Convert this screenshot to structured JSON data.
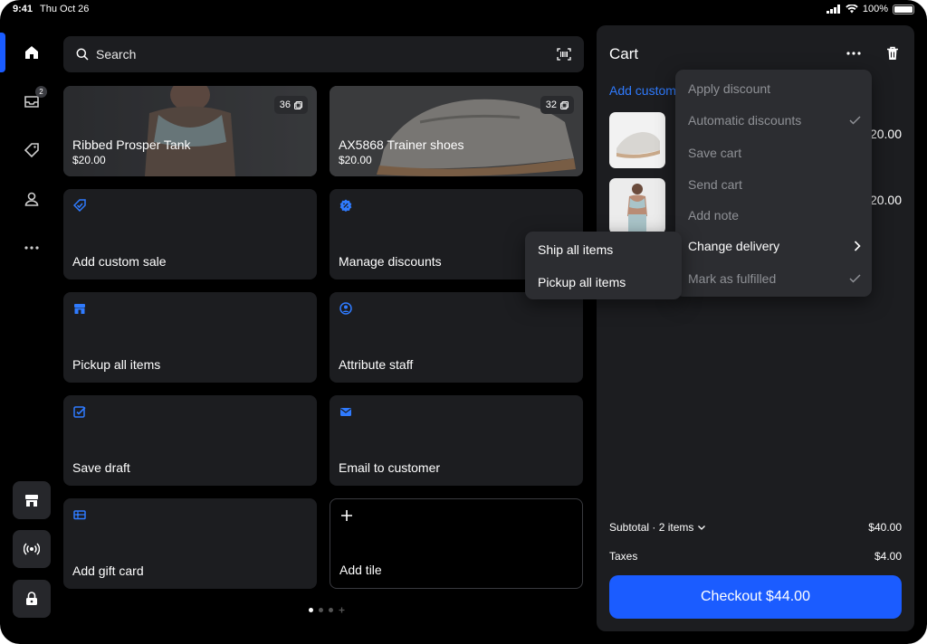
{
  "status_bar": {
    "time": "9:41",
    "date": "Thu Oct 26",
    "battery": "100%"
  },
  "sidebar": {
    "orders_badge": "2"
  },
  "search": {
    "placeholder": "Search"
  },
  "products": [
    {
      "name": "Ribbed Prosper Tank",
      "price": "$20.00",
      "count": "36"
    },
    {
      "name": "AX5868 Trainer shoes",
      "price": "$20.00",
      "count": "32"
    }
  ],
  "tiles": [
    {
      "label": "Add custom sale",
      "icon": "tag-check-icon"
    },
    {
      "label": "Manage discounts",
      "icon": "discount-badge-icon"
    },
    {
      "label": "Pickup all items",
      "icon": "store-icon"
    },
    {
      "label": "Attribute staff",
      "icon": "person-circle-icon"
    },
    {
      "label": "Save draft",
      "icon": "draft-check-icon"
    },
    {
      "label": "Email to customer",
      "icon": "mail-icon"
    },
    {
      "label": "Add gift card",
      "icon": "gift-card-icon"
    },
    {
      "label": "Add tile",
      "icon": "plus-icon"
    }
  ],
  "cart": {
    "title": "Cart",
    "add_customer": "Add customer",
    "line_items": [
      {
        "price": "$20.00"
      },
      {
        "price": "$20.00"
      }
    ],
    "subtotal_label": "Subtotal · 2 items",
    "subtotal_value": "$40.00",
    "taxes_label": "Taxes",
    "taxes_value": "$4.00",
    "checkout_label": "Checkout $44.00"
  },
  "cart_menu": [
    {
      "label": "Apply discount"
    },
    {
      "label": "Automatic discounts"
    },
    {
      "label": "Save cart"
    },
    {
      "label": "Send cart"
    },
    {
      "label": "Add note"
    },
    {
      "label": "Change delivery"
    },
    {
      "label": "Mark as fulfilled"
    }
  ],
  "delivery_submenu": [
    {
      "label": "Ship all items"
    },
    {
      "label": "Pickup all items"
    }
  ],
  "colors": {
    "accent": "#1b5cff",
    "link": "#2f7bff",
    "tile_bg": "#1c1d20",
    "menu_bg": "#2c2d31"
  }
}
